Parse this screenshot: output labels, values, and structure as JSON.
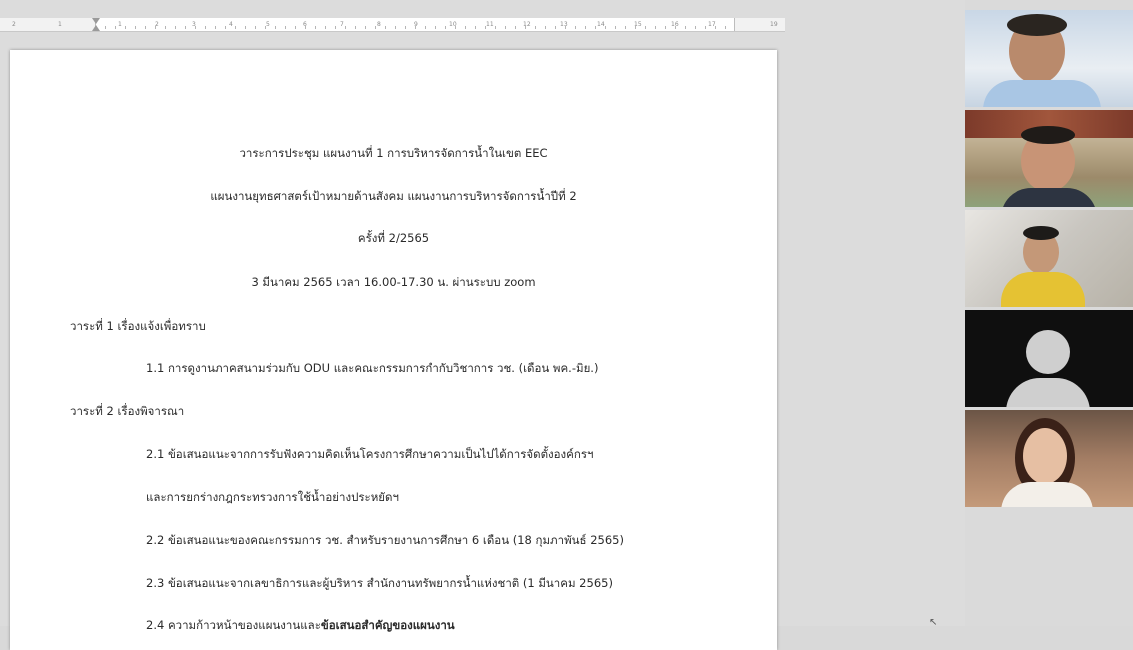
{
  "ruler": {
    "left_numbers": [
      "2",
      "1"
    ],
    "numbers": [
      "1",
      "2",
      "3",
      "4",
      "5",
      "6",
      "7",
      "8",
      "9",
      "10",
      "11",
      "12",
      "13",
      "14",
      "15",
      "16",
      "17"
    ],
    "end_number": "19"
  },
  "document": {
    "title_line1": "วาระการประชุม แผนงานที่ 1 การบริหารจัดการน้ำในเขต EEC",
    "title_line2": "แผนงานยุทธศาสตร์เป้าหมายด้านสังคม แผนงานการบริหารจัดการน้ำปีที่ 2",
    "meeting_no": "ครั้งที่ 2/2565",
    "meeting_date": "3 มีนาคม 2565 เวลา 16.00-17.30 น. ผ่านระบบ zoom",
    "agenda1_heading": "วาระที่ 1 เรื่องแจ้งเพื่อทราบ",
    "item_1_1": "1.1 การดูงานภาคสนามร่วมกับ ODU และคณะกรรมการกำกับวิชาการ วช. (เดือน พค.-มิย.)",
    "agenda2_heading": "วาระที่ 2 เรื่องพิจารณา",
    "item_2_1_a": "2.1 ข้อเสนอแนะจากการรับฟังความคิดเห็นโครงการศึกษาความเป็นไปได้การจัดตั้งองค์กรฯ",
    "item_2_1_b": "และการยกร่างกฎกระทรวงการใช้น้ำอย่างประหยัดฯ",
    "item_2_2": "2.2 ข้อเสนอแนะของคณะกรรมการ วช. สำหรับรายงานการศึกษา 6 เดือน (18 กุมภาพันธ์ 2565)",
    "item_2_3": "2.3 ข้อเสนอแนะจากเลขาธิการและผู้บริหาร สำนักงานทรัพยากรน้ำแห่งชาติ (1 มีนาคม 2565)",
    "item_2_4_prefix": "2.4 ความก้าวหน้าของแผนงานและ",
    "item_2_4_bold": "ข้อเสนอสำคัญของแผนงาน"
  },
  "participants": [
    {
      "kind": "video",
      "icon": "participant-video-1"
    },
    {
      "kind": "video",
      "icon": "participant-video-2"
    },
    {
      "kind": "video",
      "icon": "participant-video-3"
    },
    {
      "kind": "avatar",
      "icon": "user-avatar-icon"
    },
    {
      "kind": "video",
      "icon": "participant-video-5"
    }
  ],
  "colors": {
    "avatar_bg": "#0f0f0f",
    "avatar_fill": "#cfcfcf"
  }
}
